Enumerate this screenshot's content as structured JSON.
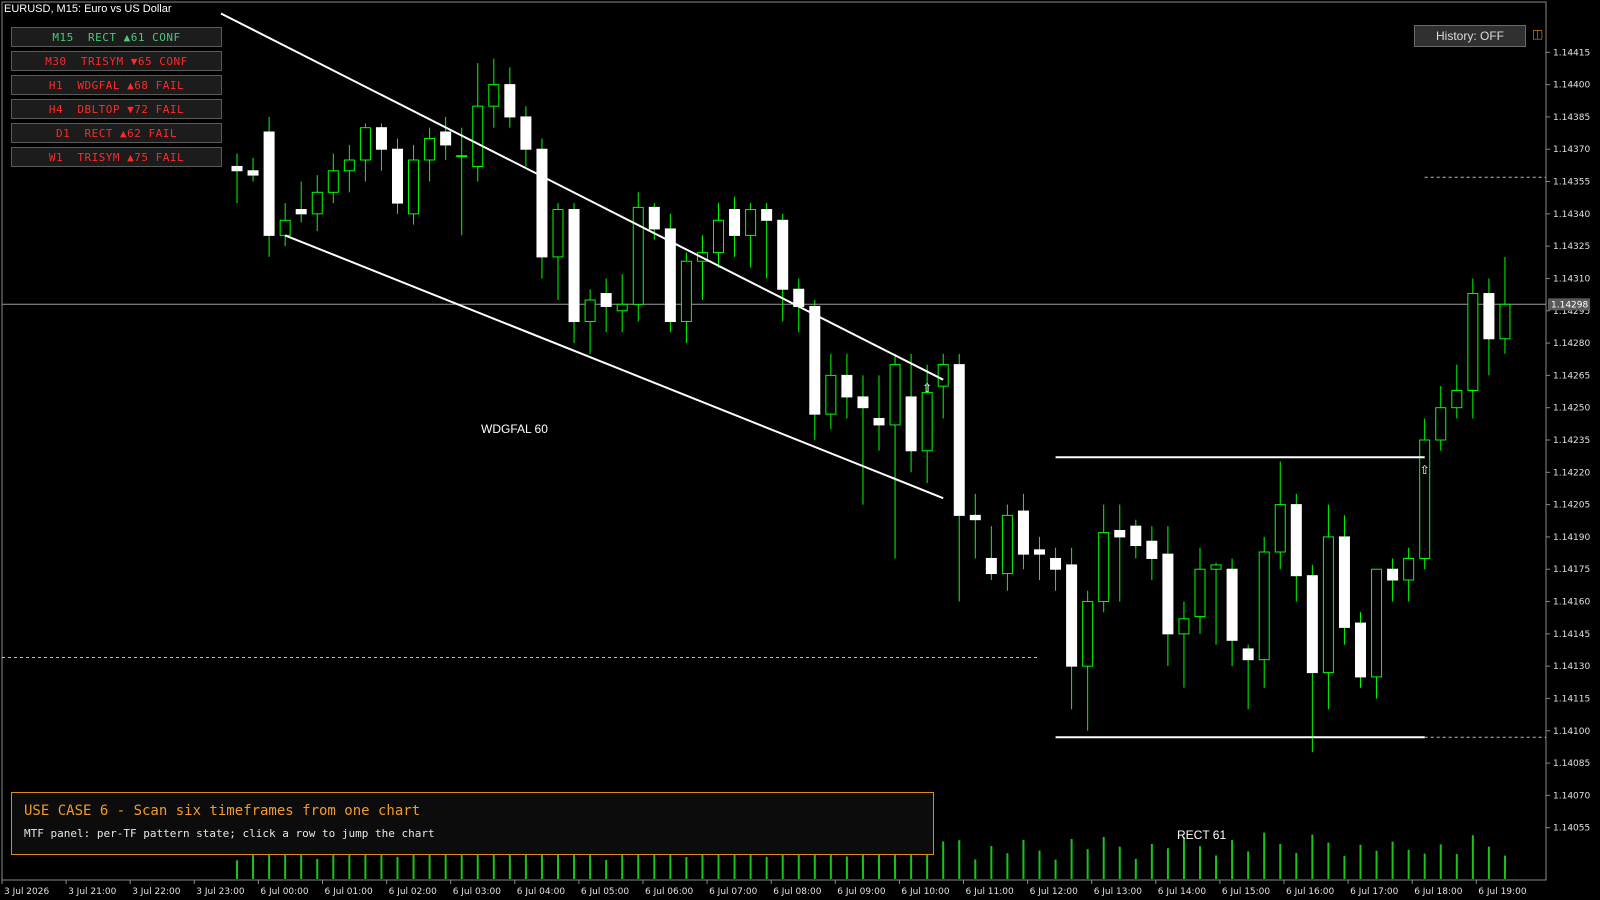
{
  "title": "EURUSD, M15:  Euro vs US Dollar",
  "colors": {
    "bull_wick": "#00ff00",
    "candle_body": "#ffffff",
    "accent": "#f39a28",
    "conf": "#4cc878",
    "fail": "#ff2a2a"
  },
  "mtf_rows": [
    {
      "text": "M15  RECT ▲61 CONF",
      "status": "conf"
    },
    {
      "text": "M30  TRISYM ▼65 CONF",
      "status": "fail"
    },
    {
      "text": "H1  WDGFAL ▲68 FAIL",
      "status": "fail"
    },
    {
      "text": "H4  DBLTOP ▼72 FAIL",
      "status": "fail"
    },
    {
      "text": "D1  RECT ▲62 FAIL",
      "status": "fail"
    },
    {
      "text": "W1  TRISYM ▲75 FAIL",
      "status": "fail"
    }
  ],
  "history_button": "History: OFF",
  "history_icon": "window-icon",
  "current_price": "1.14298",
  "price_levels": [
    "1.14415",
    "1.14400",
    "1.14385",
    "1.14370",
    "1.14355",
    "1.14340",
    "1.14325",
    "1.14310",
    "1.14295",
    "1.14280",
    "1.14265",
    "1.14250",
    "1.14235",
    "1.14220",
    "1.14205",
    "1.14190",
    "1.14175",
    "1.14160",
    "1.14145",
    "1.14130",
    "1.14115",
    "1.14100",
    "1.14085",
    "1.14070",
    "1.14055"
  ],
  "time_labels": [
    "3 Jul 2026",
    "3 Jul 21:00",
    "3 Jul 22:00",
    "3 Jul 23:00",
    "6 Jul 00:00",
    "6 Jul 01:00",
    "6 Jul 02:00",
    "6 Jul 03:00",
    "6 Jul 04:00",
    "6 Jul 05:00",
    "6 Jul 06:00",
    "6 Jul 07:00",
    "6 Jul 08:00",
    "6 Jul 09:00",
    "6 Jul 10:00",
    "6 Jul 11:00",
    "6 Jul 12:00",
    "6 Jul 13:00",
    "6 Jul 14:00",
    "6 Jul 15:00",
    "6 Jul 16:00",
    "6 Jul 17:00",
    "6 Jul 18:00",
    "6 Jul 19:00"
  ],
  "pattern_labels": {
    "wedge": "WDGFAL 60",
    "rect": "RECT 61"
  },
  "use_case": {
    "title": "USE CASE 6 - Scan six timeframes from one chart",
    "subtitle": "MTF panel: per-TF pattern state; click a row to jump the chart"
  },
  "chart_data": {
    "type": "candlestick",
    "symbol": "EURUSD",
    "timeframe": "M15",
    "ylim": [
      1.1404,
      1.1443
    ],
    "candles": [
      [
        1.14362,
        1.14368,
        1.14345,
        1.1436
      ],
      [
        1.1436,
        1.14366,
        1.14355,
        1.14358
      ],
      [
        1.14378,
        1.14385,
        1.1432,
        1.1433
      ],
      [
        1.1433,
        1.14345,
        1.14325,
        1.14337
      ],
      [
        1.14342,
        1.14355,
        1.14336,
        1.1434
      ],
      [
        1.1434,
        1.14358,
        1.14332,
        1.1435
      ],
      [
        1.1435,
        1.14368,
        1.14345,
        1.1436
      ],
      [
        1.1436,
        1.14372,
        1.1435,
        1.14365
      ],
      [
        1.14365,
        1.14382,
        1.14355,
        1.1438
      ],
      [
        1.1438,
        1.14382,
        1.1436,
        1.1437
      ],
      [
        1.1437,
        1.14375,
        1.1434,
        1.14345
      ],
      [
        1.1434,
        1.14372,
        1.14335,
        1.14365
      ],
      [
        1.14365,
        1.1438,
        1.14355,
        1.14375
      ],
      [
        1.14378,
        1.14385,
        1.14365,
        1.14372
      ],
      [
        1.14367,
        1.1438,
        1.1433,
        1.14367
      ],
      [
        1.14362,
        1.1441,
        1.14355,
        1.1439
      ],
      [
        1.1439,
        1.14412,
        1.1438,
        1.144
      ],
      [
        1.144,
        1.14408,
        1.1438,
        1.14385
      ],
      [
        1.14385,
        1.1439,
        1.14362,
        1.1437
      ],
      [
        1.1437,
        1.14375,
        1.1431,
        1.1432
      ],
      [
        1.1432,
        1.14345,
        1.143,
        1.14342
      ],
      [
        1.14342,
        1.14345,
        1.1428,
        1.1429
      ],
      [
        1.1429,
        1.14305,
        1.14275,
        1.143
      ],
      [
        1.14303,
        1.1431,
        1.14285,
        1.14297
      ],
      [
        1.14295,
        1.14312,
        1.14285,
        1.14298
      ],
      [
        1.14298,
        1.1435,
        1.1429,
        1.14343
      ],
      [
        1.14343,
        1.14345,
        1.14328,
        1.14333
      ],
      [
        1.14333,
        1.1434,
        1.14285,
        1.1429
      ],
      [
        1.1429,
        1.14322,
        1.1428,
        1.14318
      ],
      [
        1.14318,
        1.1433,
        1.143,
        1.14322
      ],
      [
        1.14322,
        1.14345,
        1.14315,
        1.14337
      ],
      [
        1.14342,
        1.14348,
        1.1432,
        1.1433
      ],
      [
        1.1433,
        1.14345,
        1.14315,
        1.14342
      ],
      [
        1.14342,
        1.14345,
        1.1431,
        1.14337
      ],
      [
        1.14337,
        1.1434,
        1.1429,
        1.14305
      ],
      [
        1.14305,
        1.1431,
        1.14285,
        1.14297
      ],
      [
        1.14297,
        1.143,
        1.14235,
        1.14247
      ],
      [
        1.14247,
        1.14275,
        1.1424,
        1.14265
      ],
      [
        1.14265,
        1.14275,
        1.14245,
        1.14255
      ],
      [
        1.14255,
        1.14265,
        1.14205,
        1.1425
      ],
      [
        1.14245,
        1.14265,
        1.1423,
        1.14242
      ],
      [
        1.14242,
        1.14275,
        1.1418,
        1.1427
      ],
      [
        1.14255,
        1.14275,
        1.1422,
        1.1423
      ],
      [
        1.1423,
        1.1427,
        1.14215,
        1.14257
      ],
      [
        1.1426,
        1.14275,
        1.14245,
        1.1427
      ],
      [
        1.1427,
        1.14275,
        1.1416,
        1.142
      ],
      [
        1.142,
        1.1421,
        1.1418,
        1.14198
      ],
      [
        1.1418,
        1.14195,
        1.1417,
        1.14173
      ],
      [
        1.14173,
        1.14205,
        1.14165,
        1.142
      ],
      [
        1.14202,
        1.1421,
        1.14175,
        1.14182
      ],
      [
        1.14184,
        1.1419,
        1.1417,
        1.14182
      ],
      [
        1.1418,
        1.14185,
        1.14165,
        1.14175
      ],
      [
        1.14177,
        1.14185,
        1.1411,
        1.1413
      ],
      [
        1.1413,
        1.14165,
        1.141,
        1.1416
      ],
      [
        1.1416,
        1.14205,
        1.14155,
        1.14192
      ],
      [
        1.14193,
        1.14205,
        1.1416,
        1.1419
      ],
      [
        1.14195,
        1.14198,
        1.1418,
        1.14186
      ],
      [
        1.14188,
        1.14195,
        1.1417,
        1.1418
      ],
      [
        1.14182,
        1.14195,
        1.1413,
        1.14145
      ],
      [
        1.14145,
        1.1416,
        1.1412,
        1.14152
      ],
      [
        1.14153,
        1.14185,
        1.14145,
        1.14175
      ],
      [
        1.14175,
        1.14178,
        1.1414,
        1.14177
      ],
      [
        1.14175,
        1.1418,
        1.1413,
        1.14142
      ],
      [
        1.14138,
        1.1414,
        1.1411,
        1.14133
      ],
      [
        1.14133,
        1.1419,
        1.1412,
        1.14183
      ],
      [
        1.14183,
        1.14225,
        1.14175,
        1.14205
      ],
      [
        1.14205,
        1.1421,
        1.1416,
        1.14172
      ],
      [
        1.14172,
        1.14177,
        1.1409,
        1.14127
      ],
      [
        1.14127,
        1.14205,
        1.1411,
        1.1419
      ],
      [
        1.1419,
        1.142,
        1.1414,
        1.14148
      ],
      [
        1.1415,
        1.14155,
        1.1412,
        1.14125
      ],
      [
        1.14125,
        1.14175,
        1.14115,
        1.14175
      ],
      [
        1.14175,
        1.1418,
        1.1416,
        1.1417
      ],
      [
        1.1417,
        1.14185,
        1.1416,
        1.1418
      ],
      [
        1.1418,
        1.14245,
        1.14175,
        1.14235
      ],
      [
        1.14235,
        1.1426,
        1.1423,
        1.1425
      ],
      [
        1.1425,
        1.1427,
        1.14245,
        1.14258
      ],
      [
        1.14258,
        1.1431,
        1.14245,
        1.14303
      ],
      [
        1.14303,
        1.1431,
        1.14265,
        1.14282
      ],
      [
        1.14282,
        1.1432,
        1.14275,
        1.14298
      ]
    ],
    "lines": [
      {
        "p1": [
          -1,
          1.14433
        ],
        "p2": [
          44,
          1.14263
        ]
      },
      {
        "p1": [
          3,
          1.1433
        ],
        "p2": [
          44,
          1.14208
        ]
      },
      {
        "p1": [
          51,
          1.14227
        ],
        "p2": [
          74,
          1.14227
        ]
      },
      {
        "p1": [
          51,
          1.14097
        ],
        "p2": [
          74,
          1.14097
        ]
      }
    ],
    "hlines": [
      {
        "price": 1.14298,
        "style": "solid",
        "color": "#9a9a9a"
      },
      {
        "price": 1.14134,
        "style": "dashed",
        "color": "#bfbfbf",
        "to_index": 50
      },
      {
        "price": 1.14097,
        "style": "dashed",
        "color": "#bfbfbf",
        "from_index": 74
      },
      {
        "price": 1.14357,
        "style": "dashed",
        "color": "#bfbfbf",
        "from_index": 74
      }
    ]
  }
}
